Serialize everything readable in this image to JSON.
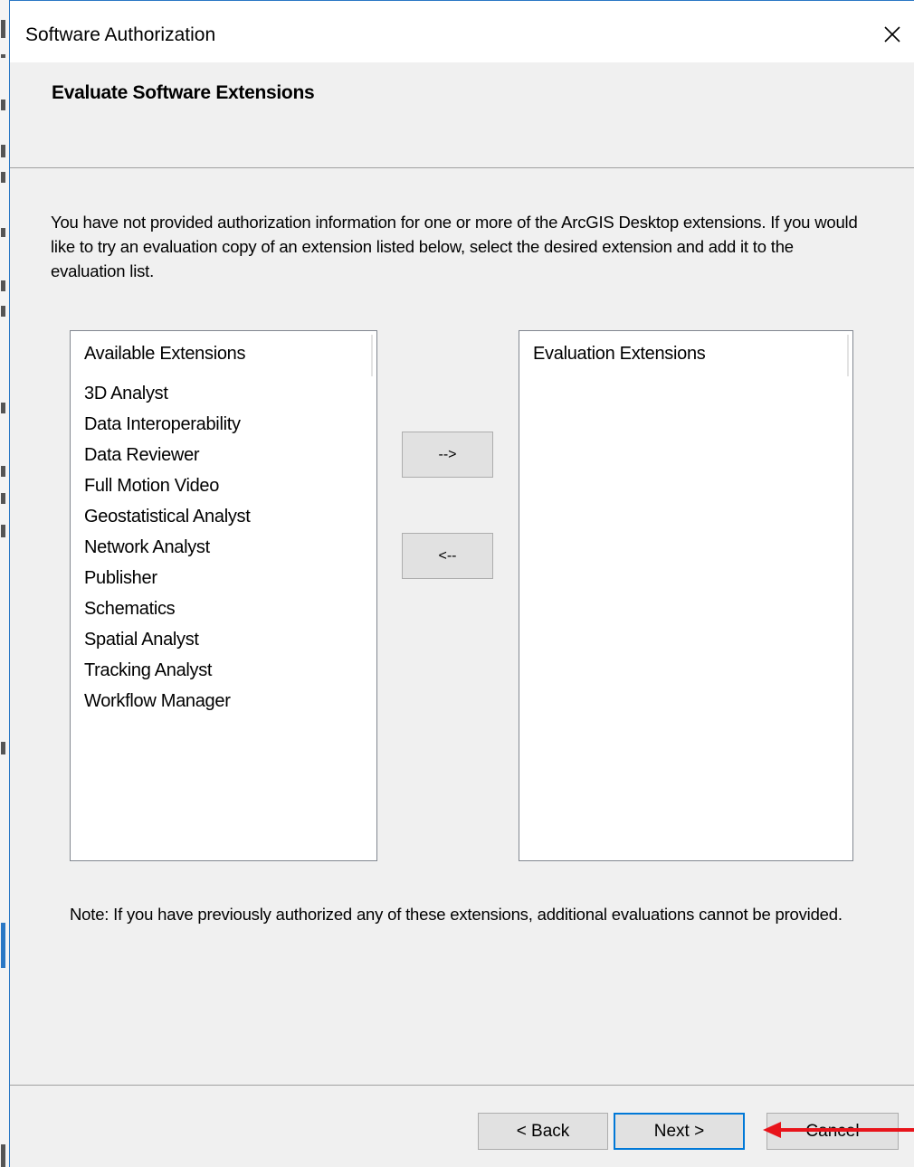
{
  "window": {
    "title": "Software Authorization"
  },
  "header": {
    "title": "Evaluate Software Extensions"
  },
  "intro": "You have not provided authorization information for one or more of the ArcGIS Desktop extensions.  If you would like to try an evaluation copy of an extension listed below, select the desired extension and add it to the evaluation list.",
  "available_list": {
    "header": "Available Extensions",
    "items": [
      "3D Analyst",
      "Data Interoperability",
      "Data Reviewer",
      "Full Motion Video",
      "Geostatistical Analyst",
      "Network Analyst",
      "Publisher",
      "Schematics",
      "Spatial Analyst",
      "Tracking Analyst",
      "Workflow Manager"
    ]
  },
  "evaluation_list": {
    "header": "Evaluation Extensions",
    "items": []
  },
  "move_buttons": {
    "add_label": "-->",
    "remove_label": "<--"
  },
  "note": "Note:  If you have previously authorized any of these extensions, additional evaluations cannot be provided.",
  "footer": {
    "back_label": "< Back",
    "next_label": "Next >",
    "cancel_label": "Cancel"
  },
  "annotation": {
    "arrow_color": "#e8141b",
    "arrow_points_to": "next-button"
  },
  "colors": {
    "focus_border": "#0078d7",
    "dialog_bg": "#f0f0f0"
  }
}
